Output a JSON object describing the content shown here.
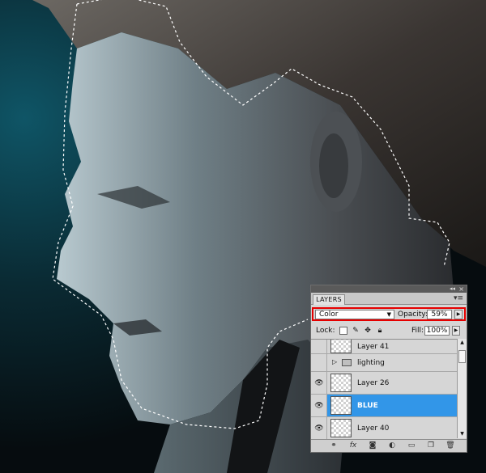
{
  "panel": {
    "tab_label": "LAYERS",
    "blend_mode": "Color",
    "opacity_label": "Opacity:",
    "opacity_value": "59%",
    "lock_label": "Lock:",
    "fill_label": "Fill:",
    "fill_value": "100%",
    "layers": [
      {
        "name": "Layer 41",
        "visible": false,
        "selected": false,
        "type": "layer"
      },
      {
        "name": "lighting",
        "visible": false,
        "selected": false,
        "type": "group"
      },
      {
        "name": "Layer 26",
        "visible": true,
        "selected": false,
        "type": "layer"
      },
      {
        "name": "BLUE",
        "visible": true,
        "selected": true,
        "type": "layer"
      },
      {
        "name": "Layer 40",
        "visible": true,
        "selected": false,
        "type": "layer"
      }
    ],
    "bottom_icons": [
      "link-icon",
      "fx-icon",
      "mask-icon",
      "adjustment-icon",
      "new-group-icon",
      "new-layer-icon",
      "trash-icon"
    ]
  },
  "colors": {
    "selection_highlight": "#3296e8",
    "callout_border": "#e60000",
    "panel_bg": "#d6d6d6",
    "backdrop_teal": "#0d4d5c"
  }
}
